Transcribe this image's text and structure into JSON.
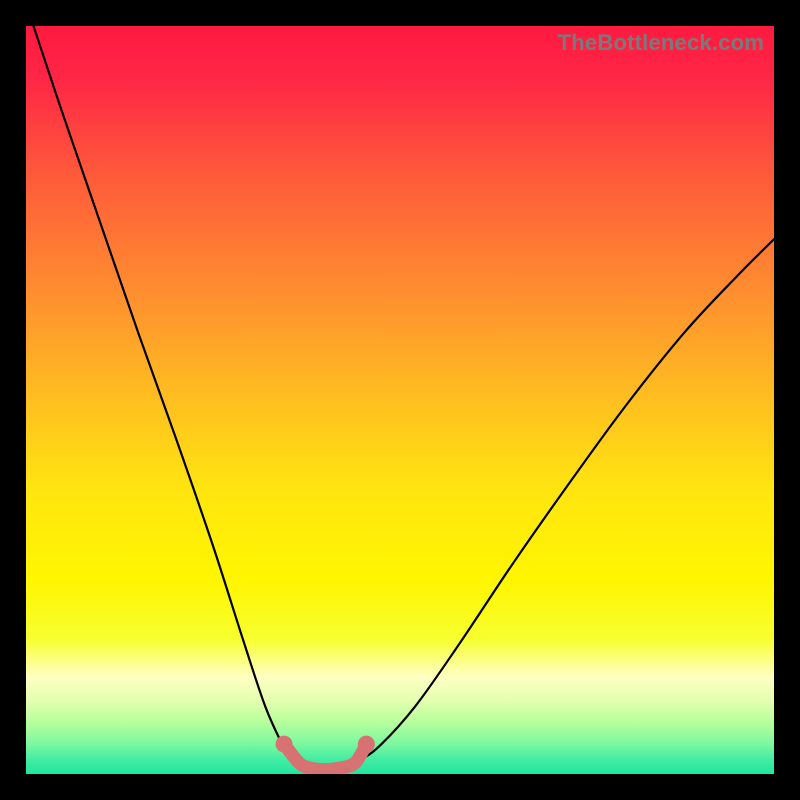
{
  "watermark": "TheBottleneck.com",
  "chart_data": {
    "type": "line",
    "title": "",
    "xlabel": "",
    "ylabel": "",
    "xlim": [
      0,
      1
    ],
    "ylim": [
      0,
      1
    ],
    "layout": {
      "legend": "none",
      "grid": false,
      "background": "vertical-gradient red→yellow→green",
      "frame": "black border outside plot area"
    },
    "gradient_stops": [
      {
        "pos": 0.0,
        "color": "#ff1a3f"
      },
      {
        "pos": 0.07,
        "color": "#ff2646"
      },
      {
        "pos": 0.2,
        "color": "#ff5a3a"
      },
      {
        "pos": 0.35,
        "color": "#ff8c30"
      },
      {
        "pos": 0.5,
        "color": "#ffbf20"
      },
      {
        "pos": 0.62,
        "color": "#ffe510"
      },
      {
        "pos": 0.74,
        "color": "#fff600"
      },
      {
        "pos": 0.82,
        "color": "#f7ff30"
      },
      {
        "pos": 0.87,
        "color": "#ffffc2"
      },
      {
        "pos": 0.9,
        "color": "#e6ffb0"
      },
      {
        "pos": 0.93,
        "color": "#b8ff9c"
      },
      {
        "pos": 0.96,
        "color": "#7cf7a0"
      },
      {
        "pos": 0.98,
        "color": "#45eda2"
      },
      {
        "pos": 1.0,
        "color": "#1ee6a0"
      }
    ],
    "series": [
      {
        "name": "left-curve",
        "stroke": "#000000",
        "x": [
          0.01,
          0.05,
          0.1,
          0.15,
          0.2,
          0.25,
          0.29,
          0.32,
          0.345,
          0.358,
          0.365
        ],
        "y": [
          1.0,
          0.88,
          0.735,
          0.59,
          0.45,
          0.305,
          0.18,
          0.09,
          0.035,
          0.015,
          0.012
        ]
      },
      {
        "name": "right-curve",
        "stroke": "#000000",
        "x": [
          0.43,
          0.44,
          0.47,
          0.52,
          0.58,
          0.65,
          0.72,
          0.8,
          0.88,
          0.95,
          1.0
        ],
        "y": [
          0.012,
          0.015,
          0.035,
          0.09,
          0.175,
          0.28,
          0.38,
          0.49,
          0.59,
          0.665,
          0.715
        ]
      },
      {
        "name": "valley-highlight",
        "stroke": "#d87272",
        "stroke_width": 13,
        "markers": true,
        "x": [
          0.345,
          0.365,
          0.38,
          0.4,
          0.42,
          0.44,
          0.455
        ],
        "y": [
          0.04,
          0.015,
          0.008,
          0.006,
          0.008,
          0.015,
          0.04
        ]
      }
    ]
  }
}
